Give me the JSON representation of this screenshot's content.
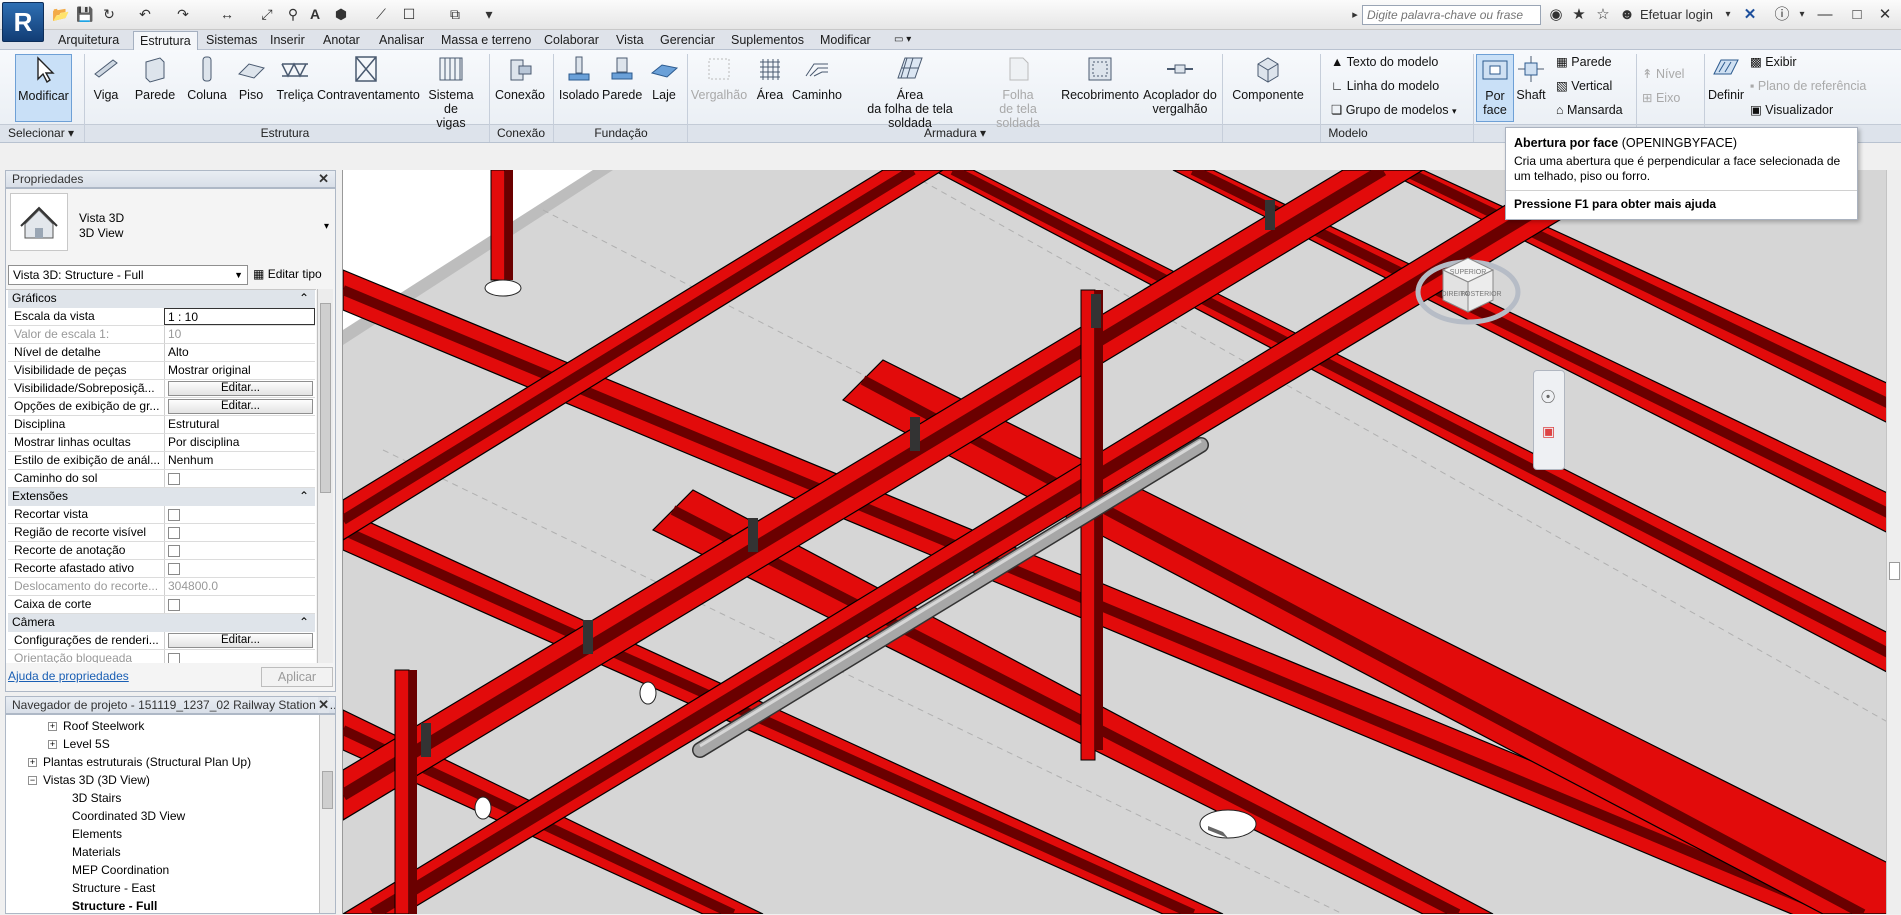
{
  "app": {
    "logo": "R"
  },
  "search": {
    "placeholder": "Digite palavra-chave ou frase"
  },
  "title_right": {
    "login": "Efetuar login"
  },
  "tabs": [
    "Arquitetura",
    "Estrutura",
    "Sistemas",
    "Inserir",
    "Anotar",
    "Analisar",
    "Massa e terreno",
    "Colaborar",
    "Vista",
    "Gerenciar",
    "Suplementos",
    "Modificar"
  ],
  "active_tab": "Estrutura",
  "ribbon": {
    "modify": "Modificar",
    "estrutura": [
      "Viga",
      "Parede",
      "Coluna",
      "Piso",
      "Treliça",
      "Contraventamento"
    ],
    "sistema_vigas": [
      "Sistema de",
      "vigas"
    ],
    "conexao": "Conexão",
    "fundacao": [
      "Isolado",
      "Parede",
      "Laje"
    ],
    "vergalhao": "Vergalhão",
    "area": "Área",
    "caminho": "Caminho",
    "area_folha": [
      "Área",
      "da folha de tela soldada"
    ],
    "folha": [
      "Folha",
      "de tela soldada"
    ],
    "recobrimento": "Recobrimento",
    "acoplador": [
      "Acoplador do",
      "vergalhão"
    ],
    "componente": "Componente",
    "modelo_items": [
      "Texto do  modelo",
      "Linha do  modelo",
      "Grupo de  modelos"
    ],
    "por_face": [
      "Por",
      "face"
    ],
    "shaft": "Shaft",
    "abertura_items": [
      "Parede",
      "Vertical",
      "Mansarda"
    ],
    "nivel": "Nível",
    "eixo": "Eixo",
    "definir": "Definir",
    "plano_items": [
      "Exibir",
      "Plano de  referência",
      "Visualizador"
    ],
    "groups": {
      "selecionar": "Selecionar",
      "estrutura": "Estrutura",
      "conexao": "Conexão",
      "fundacao": "Fundação",
      "armadura": "Armadura",
      "modelo": "Modelo"
    }
  },
  "tooltip": {
    "title": "Abertura por face",
    "command": "(OPENINGBYFACE)",
    "desc": "Cria uma abertura que é perpendicular a face selecionada de um telhado, piso ou forro.",
    "help": "Pressione F1 para obter mais ajuda"
  },
  "properties": {
    "header": "Propriedades",
    "type_name": "Vista 3D",
    "type_sub": "3D View",
    "selector": "Vista 3D: Structure - Full",
    "edit_type": "Editar tipo",
    "sections": {
      "graficos": "Gráficos",
      "extensoes": "Extensões",
      "camera": "Câmera"
    },
    "rows": [
      {
        "k": "Escala da vista",
        "v": "1 : 10"
      },
      {
        "k": "Valor de escala    1:",
        "v": "10"
      },
      {
        "k": "Nível de detalhe",
        "v": "Alto"
      },
      {
        "k": "Visibilidade de peças",
        "v": "Mostrar original"
      },
      {
        "k": "Visibilidade/Sobreposiçã...",
        "v": "Editar..."
      },
      {
        "k": "Opções de exibição de gr...",
        "v": "Editar..."
      },
      {
        "k": "Disciplina",
        "v": "Estrutural"
      },
      {
        "k": "Mostrar linhas ocultas",
        "v": "Por disciplina"
      },
      {
        "k": "Estilo de exibição de anál...",
        "v": "Nenhum"
      },
      {
        "k": "Caminho do sol",
        "v": ""
      },
      {
        "k": "Recortar vista",
        "v": ""
      },
      {
        "k": "Região de recorte visível",
        "v": ""
      },
      {
        "k": "Recorte de anotação",
        "v": ""
      },
      {
        "k": "Recorte afastado ativo",
        "v": ""
      },
      {
        "k": "Deslocamento do recorte...",
        "v": "304800.0"
      },
      {
        "k": "Caixa de corte",
        "v": ""
      },
      {
        "k": "Configurações de renderi...",
        "v": "Editar..."
      },
      {
        "k": "Orientação bloqueada",
        "v": ""
      }
    ],
    "help_link": "Ajuda de propriedades",
    "apply": "Aplicar"
  },
  "browser": {
    "header": "Navegador de projeto - 151119_1237_02 Railway Station - ...",
    "nodes": [
      "Roof Steelwork",
      "Level 5S",
      "Plantas estruturais (Structural Plan Up)",
      "Vistas 3D (3D View)",
      "3D Stairs",
      "Coordinated 3D View",
      "Elements",
      "Materials",
      "MEP Coordination",
      "Structure - East",
      "Structure - Full"
    ]
  },
  "viewcube": {
    "face1": "DIREITA",
    "face2": "POSTERIOR",
    "top": "SUPERIOR"
  },
  "colors": {
    "steel": "#e20b0b",
    "steel_dark": "#7a0000",
    "floor": "#d9d9d9",
    "pipe": "#9a9a9a",
    "ribbon_sel": "#c9e0f7"
  }
}
